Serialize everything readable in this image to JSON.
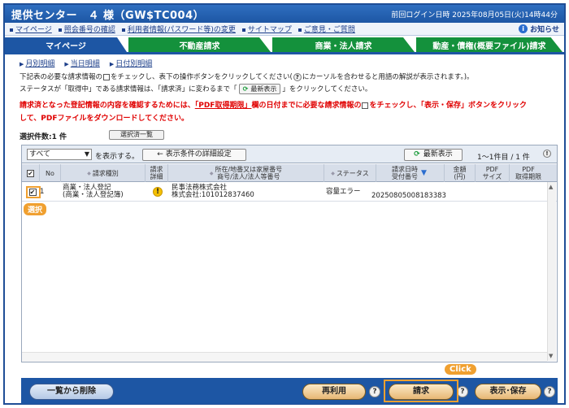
{
  "header": {
    "title": "提供センター　４ 様（GW$TC004）",
    "last_login": "前回ログイン日時 2025年08月05日(火)14時44分"
  },
  "linkbar": {
    "links": [
      "マイページ",
      "照会番号の確認",
      "利用者情報(パスワード等)の変更",
      "サイトマップ",
      "ご意見・ご質問"
    ],
    "notice": "お知らせ"
  },
  "tabs": [
    "マイページ",
    "不動産請求",
    "商業・法人請求",
    "動産・債権(概要ファイル)請求"
  ],
  "sublinks": [
    "月別明細",
    "当日明細",
    "日付別明細"
  ],
  "instructions": {
    "line1_a": "下記表の必要な請求情報の",
    "line1_b": "をチェックし、表下の操作ボタンをクリックしてください(",
    "line1_c": "にカーソルを合わせると用語の解説が表示されます。)。",
    "line2_a": "ステータスが「取得中」である請求情報は、「請求済」に変わるまで「",
    "line2_btn": "最新表示",
    "line2_b": "」をクリックしてください。",
    "warn1_a": "請求済となった登記情報の内容を確認するためには、",
    "warn1_ul": "「PDF取得期限」",
    "warn1_b": "欄の日付までに必要な請求情報の",
    "warn1_c": "をチェックし、「表示・保存」ボタンをクリック",
    "warn2": "して、PDFファイルをダウンロードしてください。"
  },
  "selection": {
    "count_label": "選択件数:1 件",
    "list_button": "選択済一覧"
  },
  "toolbar": {
    "filter_value": "すべて",
    "filter_suffix": "を表示する。",
    "condition_button": "← 表示条件の詳細設定",
    "refresh_button": "最新表示",
    "page_info": "1〜1件目 / 1 件"
  },
  "table": {
    "columns": {
      "no": "No",
      "type": "請求種別",
      "detail": "請求\n詳細",
      "location": "所在/地番又は家屋番号\n商号/法人/法人等番号",
      "status": "ステータス",
      "datetime": "請求日時\n受付番号",
      "amount": "金額\n(円)",
      "pdf_size": "PDF\nサイズ",
      "pdf_deadline": "PDF\n取得期限"
    },
    "rows": [
      {
        "checked": "✔",
        "no": "1",
        "type_line1": "商業・法人登記",
        "type_line2": "(商業・法人登記簿)",
        "detail_icon": "!",
        "location_line1": "民事法務株式会社",
        "location_line2": "株式会社:101012837460",
        "status": "容量エラー",
        "datetime": "20250805008183383",
        "amount": "",
        "pdf_size": "",
        "pdf_deadline": ""
      }
    ]
  },
  "annotations": {
    "select_badge": "選択",
    "click_badge": "Click"
  },
  "bottom": {
    "delete_button": "一覧から削除",
    "reuse_button": "再利用",
    "request_button": "請求",
    "view_save_button": "表示･保存",
    "help": "?"
  },
  "colors": {
    "primary_blue": "#1d56a4",
    "tab_green": "#14913c",
    "warning_red": "#e00000",
    "highlight_orange": "#f0a030"
  },
  "icons": [
    "info-icon",
    "refresh-icon",
    "help-icon",
    "warning-icon",
    "checkbox-icon"
  ]
}
